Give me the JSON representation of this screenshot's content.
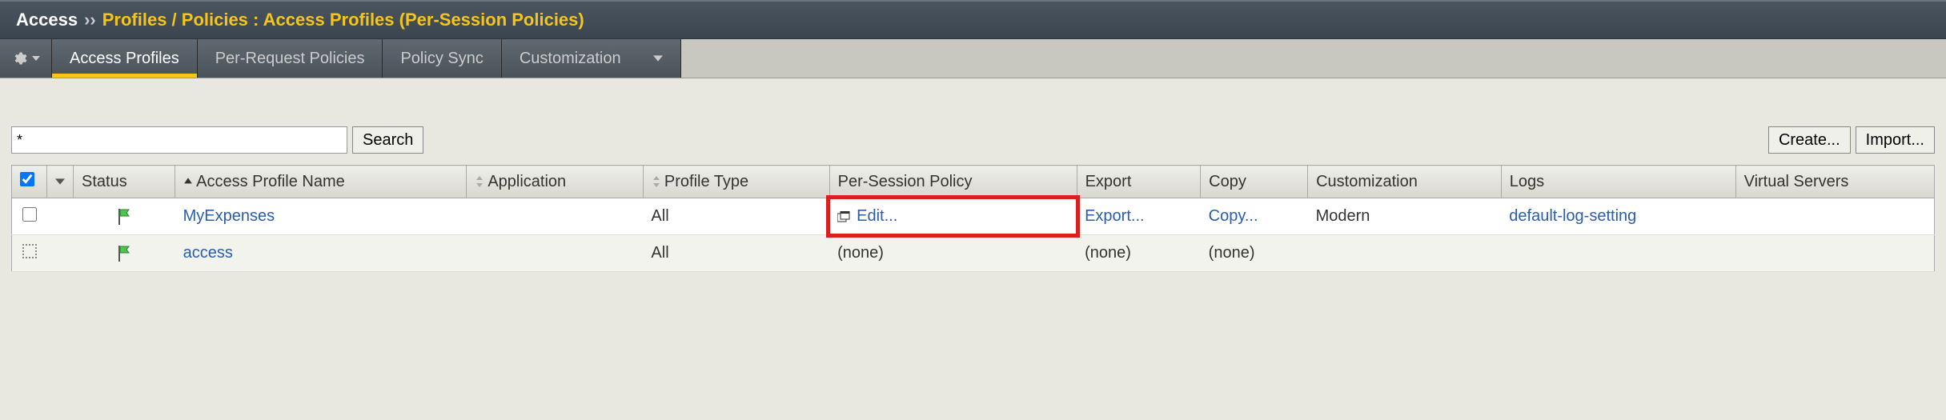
{
  "breadcrumb": {
    "section": "Access",
    "separator": "››",
    "path": "Profiles / Policies : Access Profiles (Per-Session Policies)"
  },
  "tabs": {
    "items": [
      {
        "label": "Access Profiles",
        "active": true
      },
      {
        "label": "Per-Request Policies",
        "active": false
      },
      {
        "label": "Policy Sync",
        "active": false
      },
      {
        "label": "Customization",
        "active": false,
        "dropdown": true
      }
    ]
  },
  "toolbar": {
    "search_value": "*",
    "search_btn": "Search",
    "create_btn": "Create...",
    "import_btn": "Import..."
  },
  "table": {
    "columns": {
      "status": "Status",
      "name": "Access Profile Name",
      "application": "Application",
      "profile_type": "Profile Type",
      "per_session": "Per-Session Policy",
      "export": "Export",
      "copy": "Copy",
      "customization": "Customization",
      "logs": "Logs",
      "virtual_servers": "Virtual Servers"
    },
    "rows": [
      {
        "checkbox": "empty",
        "name": "MyExpenses",
        "application": "",
        "profile_type": "All",
        "per_session": "Edit...",
        "per_session_highlight": true,
        "export": "Export...",
        "copy": "Copy...",
        "customization": "Modern",
        "logs": "default-log-setting",
        "virtual_servers": ""
      },
      {
        "checkbox": "dotted",
        "name": "access",
        "application": "",
        "profile_type": "All",
        "per_session": "(none)",
        "per_session_highlight": false,
        "export": "(none)",
        "copy": "(none)",
        "customization": "",
        "logs": "",
        "virtual_servers": ""
      }
    ]
  }
}
